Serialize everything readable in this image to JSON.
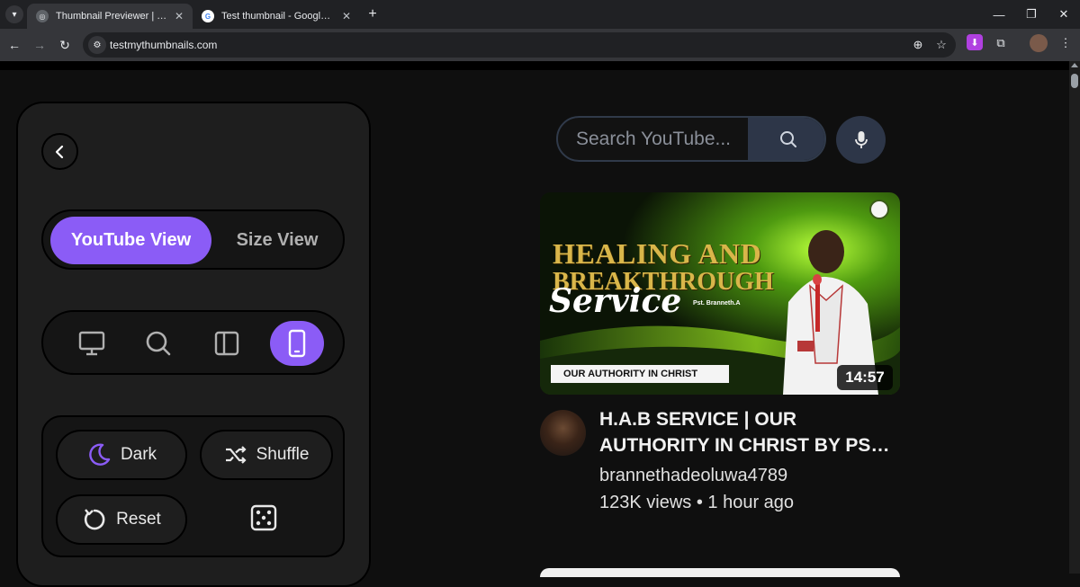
{
  "browser": {
    "tabs": [
      {
        "title": "Thumbnail Previewer | TmT Test",
        "active": true
      },
      {
        "title": "Test thumbnail - Google Search",
        "active": false
      }
    ],
    "url": "testmythumbnails.com"
  },
  "panel": {
    "view_toggle": {
      "youtube": "YouTube View",
      "size": "Size View",
      "selected": "youtube"
    },
    "devices": [
      {
        "icon": "desktop-icon",
        "active": false
      },
      {
        "icon": "search-icon",
        "active": false
      },
      {
        "icon": "sidebar-icon",
        "active": false
      },
      {
        "icon": "mobile-icon",
        "active": true
      }
    ],
    "actions": {
      "dark": "Dark",
      "shuffle": "Shuffle",
      "reset": "Reset"
    },
    "accent": "#8b5cf6"
  },
  "youtube": {
    "search_placeholder": "Search YouTube...",
    "thumbnail": {
      "line1": "HEALING AND",
      "line2": "BREAKTHROUGH",
      "script": "Service",
      "pastor": "Pst. Branneth.A",
      "band": "OUR AUTHORITY IN CHRIST"
    },
    "duration": "14:57",
    "title": "H.A.B SERVICE | OUR AUTHORITY IN CHRIST BY PST BRANNETH ADEOLUWA",
    "channel": "brannethadeoluwa4789",
    "meta": "123K views • 1 hour ago"
  }
}
